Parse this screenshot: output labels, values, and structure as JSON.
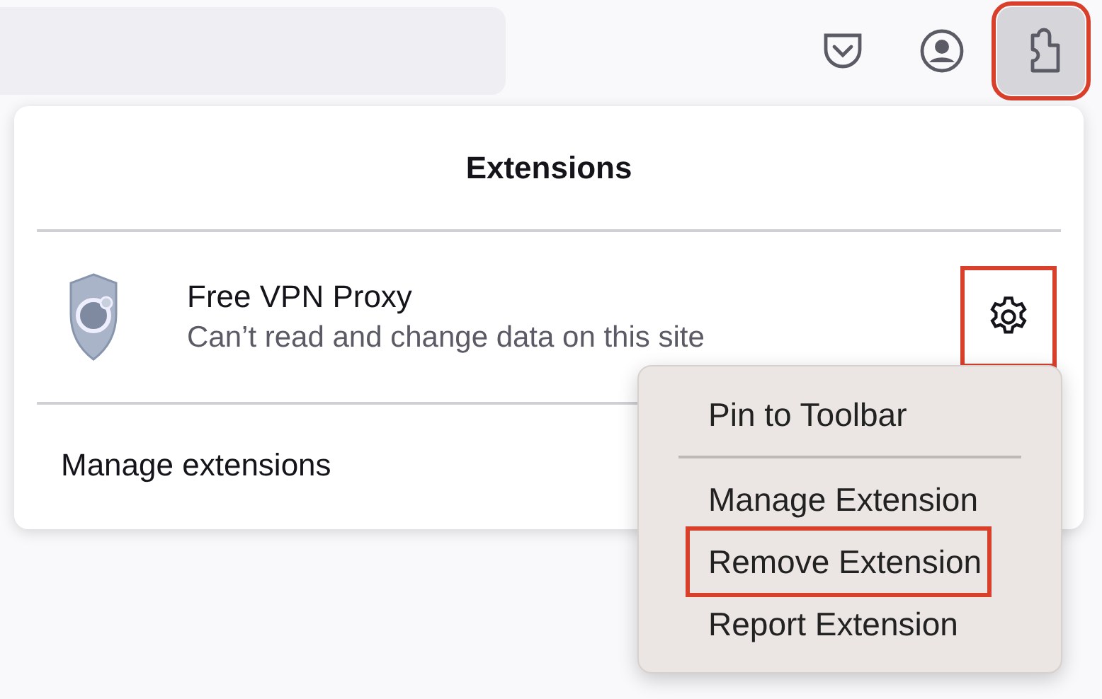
{
  "toolbar": {
    "buttons": [
      {
        "kind": "pocket",
        "pressed": false,
        "annotated": false
      },
      {
        "kind": "account",
        "pressed": false,
        "annotated": false
      },
      {
        "kind": "extensions",
        "pressed": true,
        "annotated": true
      }
    ]
  },
  "panel": {
    "title": "Extensions",
    "extension": {
      "name": "Free VPN Proxy",
      "status": "Can’t read and change data on this site",
      "settings_annotated": true
    },
    "manage_link": "Manage extensions"
  },
  "context_menu": {
    "items": [
      {
        "kind": "item",
        "label": "Pin to Toolbar",
        "annotated": false
      },
      {
        "kind": "separator"
      },
      {
        "kind": "item",
        "label": "Manage Extension",
        "annotated": false
      },
      {
        "kind": "item",
        "label": "Remove Extension",
        "annotated": true
      },
      {
        "kind": "item",
        "label": "Report Extension",
        "annotated": false
      }
    ]
  }
}
